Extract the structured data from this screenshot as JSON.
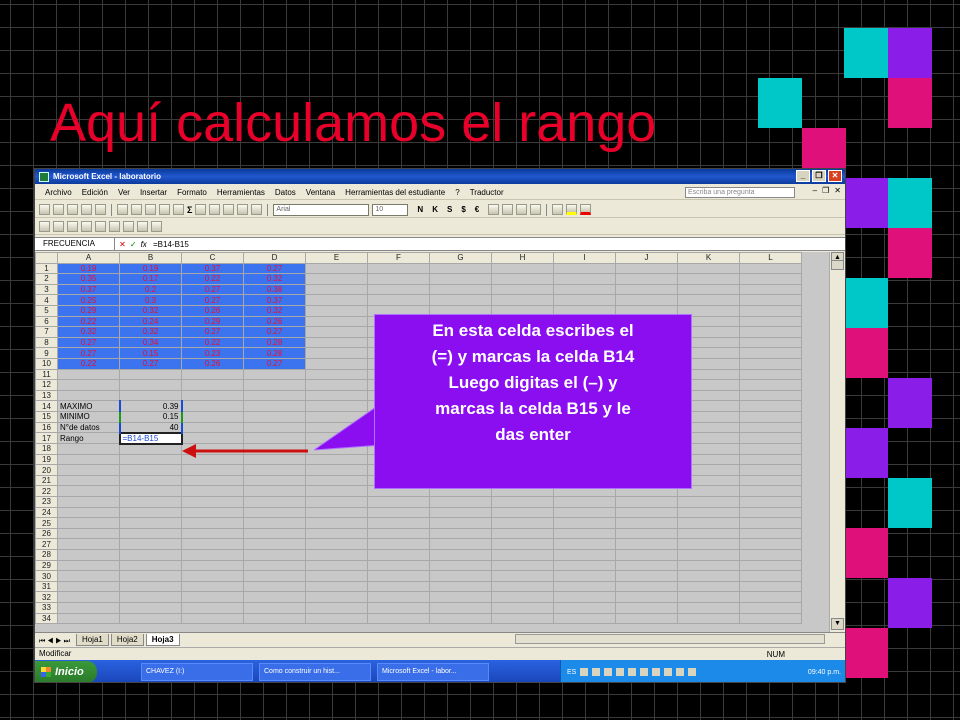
{
  "slide": {
    "title": "Aquí calculamos el rango",
    "callout": [
      "En esta celda escribes el",
      "(=) y marcas la celda B14",
      "Luego digitas el (–) y",
      "marcas la celda B15 y le",
      "das enter"
    ]
  },
  "colors": {
    "title": "#e8002a",
    "callout_bg": "#8a0ef0",
    "selection_blue": "#3c74f0",
    "values_red": "#e81030",
    "arrow": "#cc1010"
  },
  "excel": {
    "window_title": "Microsoft Excel - laboratorio",
    "menu": [
      "Archivo",
      "Edición",
      "Ver",
      "Insertar",
      "Formato",
      "Herramientas",
      "Datos",
      "Ventana",
      "Herramientas del estudiante",
      "?",
      "Traductor"
    ],
    "ask_placeholder": "Escriba una pregunta",
    "font_name": "Arial",
    "font_size": "10",
    "format_buttons": [
      "N",
      "K",
      "S",
      "$",
      "€"
    ],
    "name_box": "FRECUENCIA",
    "formula": "=B14-B15",
    "columns": [
      "A",
      "B",
      "C",
      "D",
      "E",
      "F",
      "G",
      "H",
      "I",
      "J",
      "K",
      "L"
    ],
    "rows": [
      [
        "0.19",
        "0.19",
        "0.37",
        "0.27"
      ],
      [
        "0.35",
        "0.17",
        "0.22",
        "0.32"
      ],
      [
        "0.37",
        "0.2",
        "0.27",
        "0.38"
      ],
      [
        "0.25",
        "0.3",
        "0.27",
        "0.37"
      ],
      [
        "0.29",
        "0.32",
        "0.26",
        "0.32"
      ],
      [
        "0.22",
        "0.24",
        "0.29",
        "0.26"
      ],
      [
        "0.32",
        "0.32",
        "0.27",
        "0.27"
      ],
      [
        "0.27",
        "0.34",
        "0.22",
        "0.28"
      ],
      [
        "0.27",
        "0.15",
        "0.23",
        "0.28"
      ],
      [
        "0.22",
        "0.27",
        "0.26",
        "0.27"
      ]
    ],
    "stats": [
      {
        "row": 14,
        "label": "MAXIMO",
        "value": "0.39"
      },
      {
        "row": 15,
        "label": "MINIMO",
        "value": "0.15"
      },
      {
        "row": 16,
        "label": "N°de datos",
        "value": "40"
      },
      {
        "row": 17,
        "label": "Rango",
        "value": "=B14-B15"
      }
    ],
    "sheet_tabs": [
      "Hoja1",
      "Hoja2",
      "Hoja3"
    ],
    "active_tab": "Hoja3",
    "status": "Modificar",
    "status_num": "NUM"
  },
  "taskbar": {
    "start": "Inicio",
    "tasks": [
      "CHAVEZ (I:)",
      "Como construir un hist...",
      "Microsoft Excel - labor..."
    ],
    "lang": "ES",
    "clock": "09:40 p.m."
  }
}
